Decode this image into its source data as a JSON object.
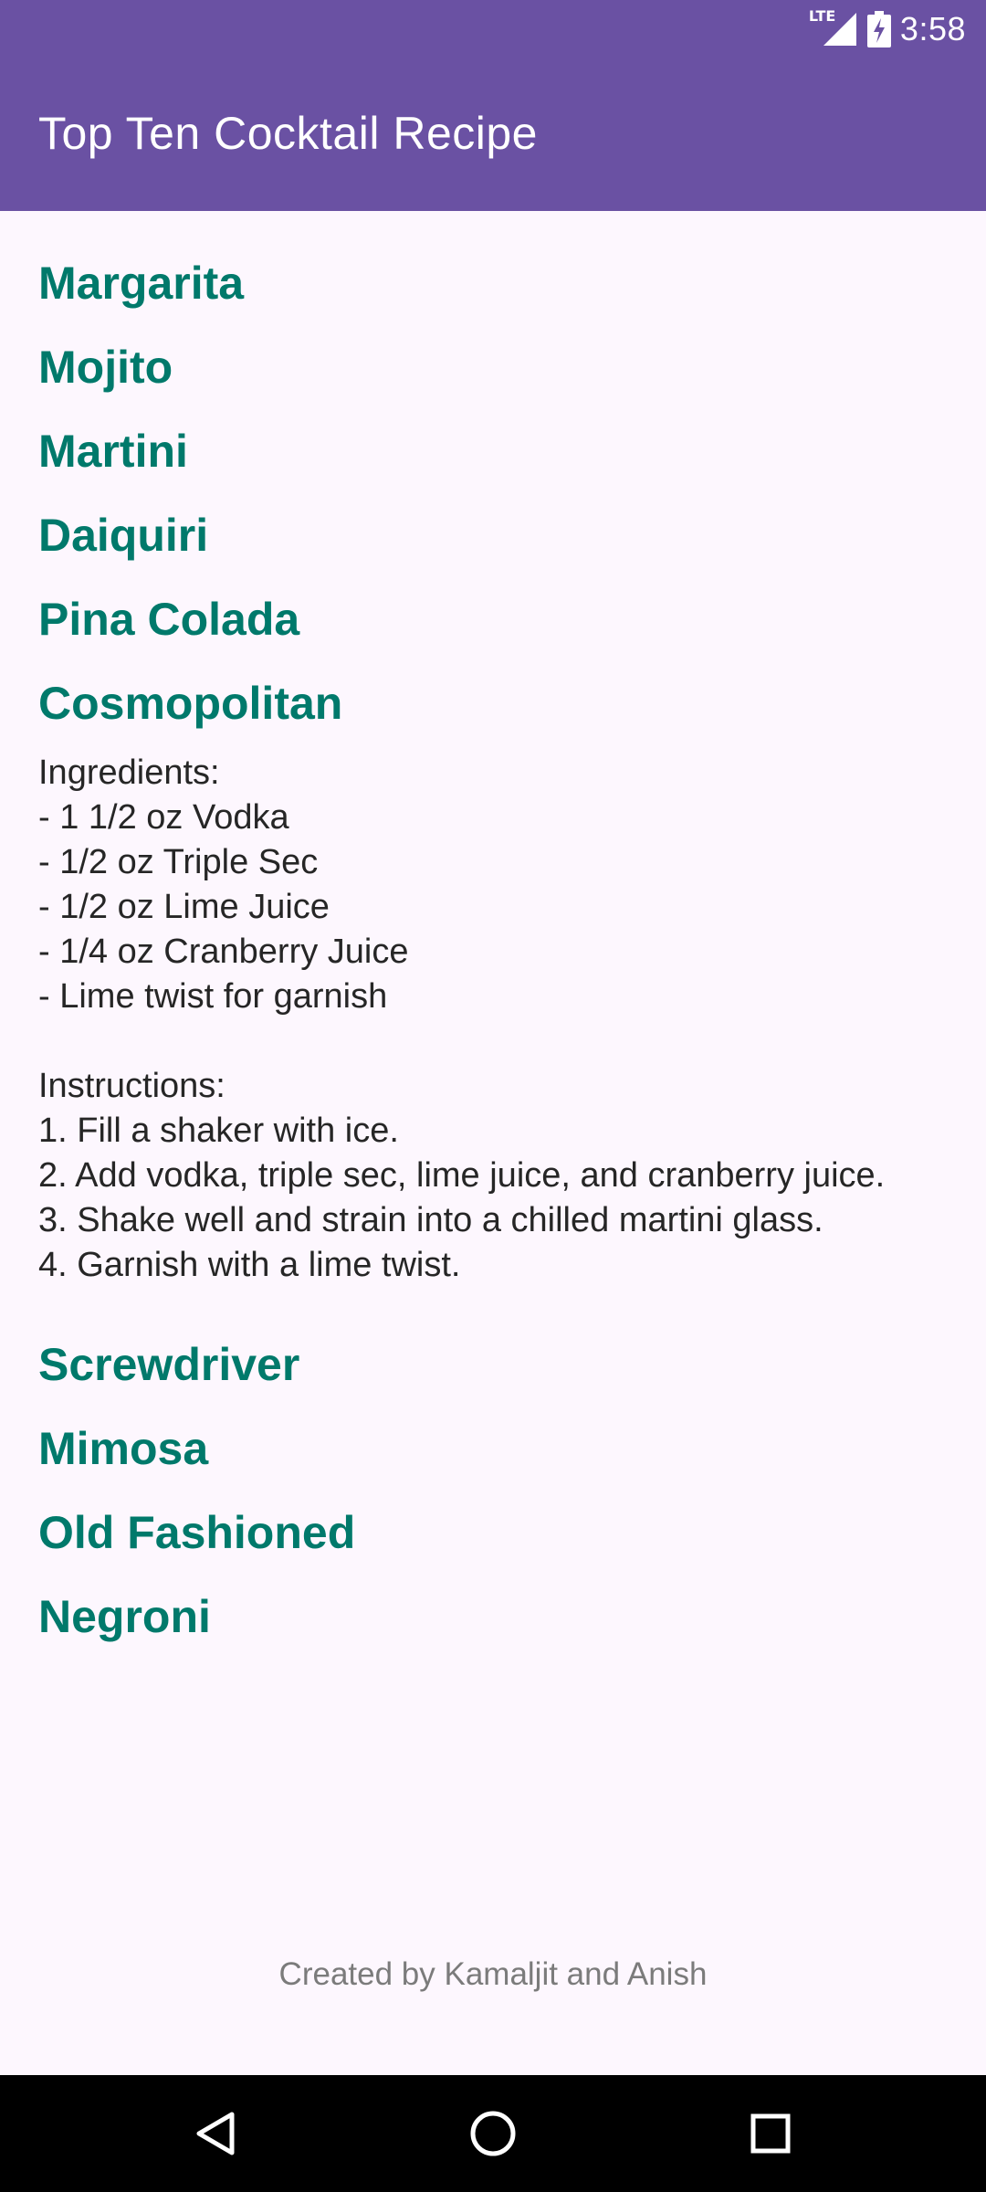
{
  "status_bar": {
    "network_label": "LTE",
    "time": "3:58",
    "icons": [
      "signal-icon",
      "battery-charging-icon"
    ]
  },
  "header": {
    "title": "Top Ten Cocktail Recipe",
    "background_color": "#6a51a3"
  },
  "cocktails": [
    {
      "name": "Margarita",
      "expanded": false
    },
    {
      "name": "Mojito",
      "expanded": false
    },
    {
      "name": "Martini",
      "expanded": false
    },
    {
      "name": "Daiquiri",
      "expanded": false
    },
    {
      "name": "Pina Colada",
      "expanded": false
    },
    {
      "name": "Cosmopolitan",
      "expanded": true,
      "recipe": "Ingredients:\n- 1 1/2 oz Vodka\n- 1/2 oz Triple Sec\n- 1/2 oz Lime Juice\n- 1/4 oz Cranberry Juice\n- Lime twist for garnish\n\nInstructions:\n1. Fill a shaker with ice.\n2. Add vodka, triple sec, lime juice, and cranberry juice.\n3. Shake well and strain into a chilled martini glass.\n4. Garnish with a lime twist."
    },
    {
      "name": "Screwdriver",
      "expanded": false
    },
    {
      "name": "Mimosa",
      "expanded": false
    },
    {
      "name": "Old Fashioned",
      "expanded": false
    },
    {
      "name": "Negroni",
      "expanded": false
    }
  ],
  "footer": {
    "credit": "Created by Kamaljit and Anish"
  },
  "nav_bar": {
    "icons": [
      "back-icon",
      "home-icon",
      "recents-icon"
    ]
  },
  "colors": {
    "accent": "#00796b",
    "text": "#262626",
    "background": "#fdf7fe"
  }
}
